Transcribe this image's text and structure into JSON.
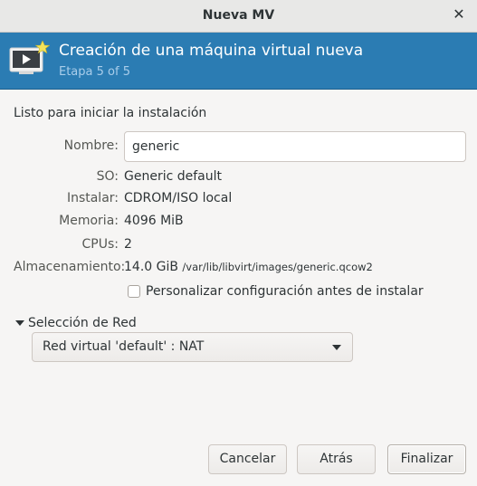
{
  "window": {
    "title": "Nueva MV",
    "close_glyph": "✕"
  },
  "banner": {
    "title": "Creación de una máquina virtual nueva",
    "step": "Etapa 5 of 5",
    "icon": "new-vm-icon"
  },
  "summary": {
    "heading": "Listo para iniciar la instalación",
    "name_label": "Nombre:",
    "name_value": "generic",
    "os_label": "SO:",
    "os_value": "Generic default",
    "install_label": "Instalar:",
    "install_value": "CDROM/ISO local",
    "memory_label": "Memoria:",
    "memory_value": "4096 MiB",
    "cpus_label": "CPUs:",
    "cpus_value": "2",
    "storage_label": "Almacenamiento:",
    "storage_size": "14.0 GiB",
    "storage_path": "/var/lib/libvirt/images/generic.qcow2",
    "customize_label": "Personalizar configuración antes de instalar",
    "customize_checked": false
  },
  "network": {
    "expander_label": "Selección de Red",
    "selected": "Red virtual 'default' : NAT"
  },
  "buttons": {
    "cancel": "Cancelar",
    "back": "Atrás",
    "finish": "Finalizar"
  },
  "colors": {
    "banner_bg": "#2b7cb3",
    "banner_subtitle": "#a9cdea"
  }
}
